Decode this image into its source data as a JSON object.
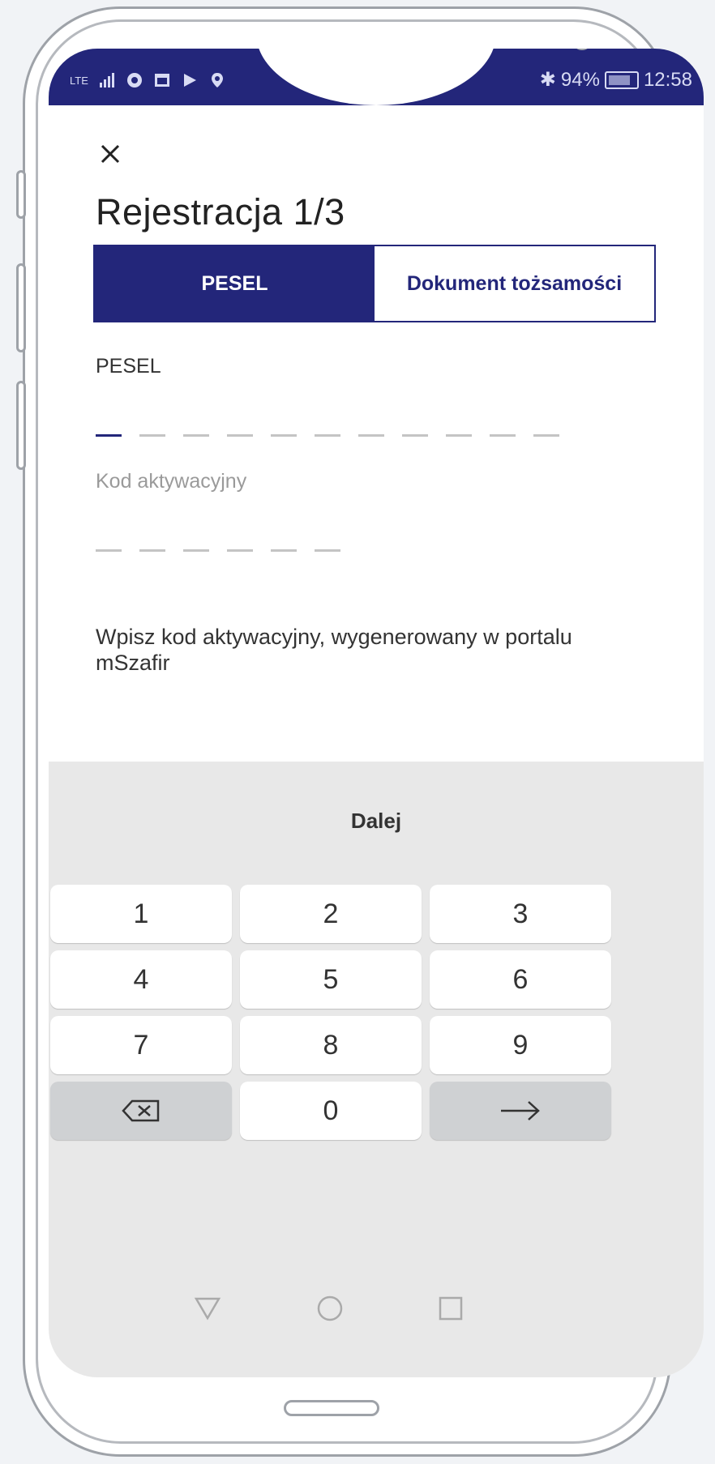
{
  "status_bar": {
    "network": "LTE",
    "battery": "94%",
    "time": "12:58"
  },
  "screen": {
    "title": "Rejestracja 1/3",
    "close_icon": "close-icon"
  },
  "tabs": [
    {
      "label": "PESEL",
      "active": true
    },
    {
      "label": "Dokument tożsamości",
      "active": false
    }
  ],
  "pesel_field": {
    "label": "PESEL",
    "value": "",
    "length": 11
  },
  "code_field": {
    "label": "Kod aktywacyjny",
    "value": "",
    "length": 6
  },
  "helper_text": "Wpisz kod aktywacyjny, wygenerowany w portalu mSzafir",
  "keyboard": {
    "action_label": "Dalej",
    "keys": [
      "1",
      "2",
      "3",
      "4",
      "5",
      "6",
      "7",
      "8",
      "9",
      "0"
    ]
  },
  "colors": {
    "brand": "#23267a",
    "keyboard_bg": "#e8e8e8"
  }
}
